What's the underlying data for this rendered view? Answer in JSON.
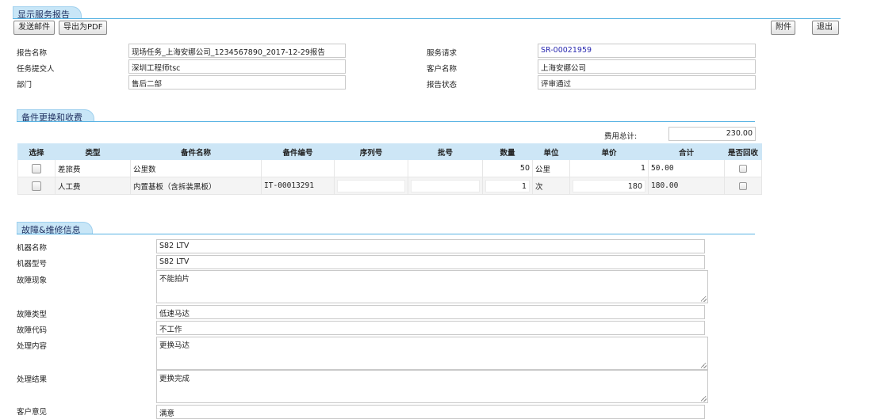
{
  "page": {
    "title": "显示服务报告",
    "buttons": {
      "send_email": "发送邮件",
      "export_pdf": "导出为PDF",
      "attachment": "附件",
      "exit": "退出"
    }
  },
  "report": {
    "name_label": "报告名称",
    "name_value": "现场任务_上海安娜公司_1234567890_2017-12-29报告",
    "submitter_label": "任务提交人",
    "submitter_value": "深圳工程师tsc",
    "dept_label": "部门",
    "dept_value": "售后二部",
    "request_label": "服务请求",
    "request_value": "SR-00021959",
    "customer_label": "客户名称",
    "customer_value": "上海安娜公司",
    "status_label": "报告状态",
    "status_value": "评审通过"
  },
  "parts": {
    "section_title": "备件更换和收费",
    "total_label": "费用总计:",
    "total_value": "230.00",
    "columns": [
      "选择",
      "类型",
      "备件名称",
      "备件编号",
      "序列号",
      "批号",
      "数量",
      "单位",
      "单价",
      "合计",
      "是否回收"
    ],
    "rows": [
      {
        "type": "差旅费",
        "part_name": "公里数",
        "part_no": "",
        "serial": "",
        "batch": "",
        "qty": "50",
        "unit": "公里",
        "price": "1",
        "subtotal": "50.00"
      },
      {
        "type": "人工费",
        "part_name": "内置基板（含拆装黑板）",
        "part_no": "IT-00013291",
        "serial": "",
        "batch": "",
        "qty": "1",
        "unit": "次",
        "price": "180",
        "subtotal": "180.00"
      }
    ]
  },
  "fault": {
    "section_title": "故障&维修信息",
    "machine_name_label": "机器名称",
    "machine_name_value": "S82 LTV",
    "machine_model_label": "机器型号",
    "machine_model_value": "S82 LTV",
    "symptom_label": "故障现象",
    "symptom_value": "不能拍片",
    "fault_type_label": "故障类型",
    "fault_type_value": "低速马达",
    "fault_code_label": "故障代码",
    "fault_code_value": "不工作",
    "handling_label": "处理内容",
    "handling_value": "更换马达",
    "result_label": "处理结果",
    "result_value": "更换完成",
    "opinion_label": "客户意见",
    "opinion_value": "满意"
  }
}
